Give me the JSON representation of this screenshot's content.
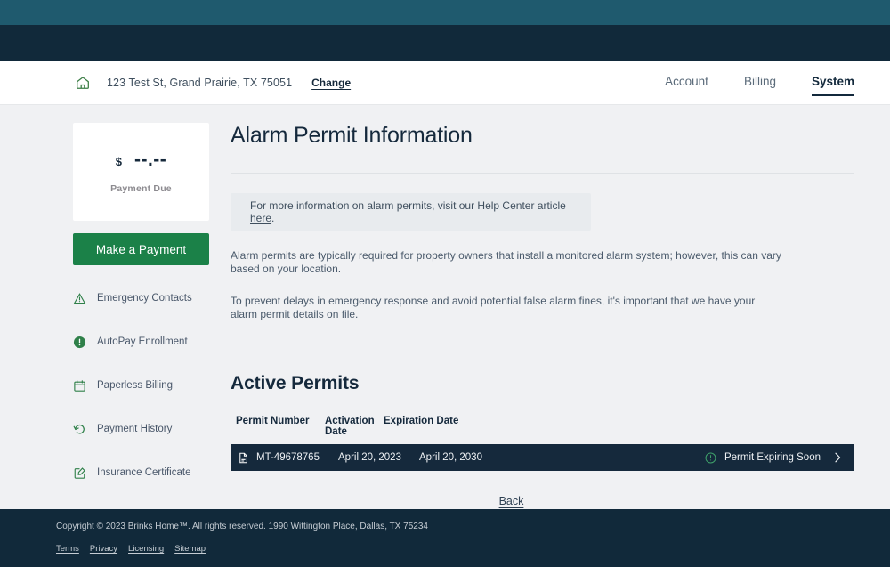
{
  "colors": {
    "top_bar_teal": "#1f5a6e",
    "top_bar_navy": "#11293a",
    "page_bg": "#f0f1f3",
    "brand_green": "#1b8148",
    "dark_navy": "#15293c",
    "status_green": "#3ea06a"
  },
  "header": {
    "home_icon": "home-icon",
    "address": "123 Test St, Grand Prairie, TX 75051",
    "change_label": "Change",
    "nav": [
      {
        "label": "Account",
        "active": false
      },
      {
        "label": "Billing",
        "active": false
      },
      {
        "label": "System",
        "active": true
      }
    ]
  },
  "sidebar": {
    "payment_card": {
      "currency_symbol": "$",
      "amount": "--.--",
      "label": "Payment Due"
    },
    "pay_button_label": "Make a Payment",
    "items": [
      {
        "label": "Emergency Contacts",
        "icon": "warning-triangle-icon"
      },
      {
        "label": "AutoPay Enrollment",
        "icon": "exclamation-circle-icon"
      },
      {
        "label": "Paperless Billing",
        "icon": "calendar-icon"
      },
      {
        "label": "Payment History",
        "icon": "history-icon"
      },
      {
        "label": "Insurance Certificate",
        "icon": "edit-document-icon"
      }
    ]
  },
  "main": {
    "page_title": "Alarm Permit Information",
    "info_banner": {
      "text_before": "For more information on alarm permits, visit our Help Center article ",
      "link_label": "here",
      "text_after": "."
    },
    "paragraphs": [
      "Alarm permits are typically required for property owners that install a monitored alarm system; however, this can vary based on your location.",
      "To prevent delays in emergency response and avoid potential false alarm fines, it's important that we have your alarm permit details on file."
    ],
    "section_title": "Active Permits",
    "table": {
      "columns": [
        "Permit Number",
        "Activation Date",
        "Expiration Date"
      ],
      "rows": [
        {
          "icon": "document-icon",
          "permit_number": "MT-49678765",
          "activation_date": "April 20, 2023",
          "expiration_date": "April 20, 2030",
          "status_icon": "exclamation-circle-outline-icon",
          "status": "Permit Expiring Soon",
          "chevron": "chevron-right-icon"
        }
      ]
    },
    "back_label": "Back"
  },
  "footer": {
    "copyright": "Copyright © 2023 Brinks Home™. All rights reserved. 1990 Wittington Place, Dallas, TX 75234",
    "links": [
      "Terms",
      "Privacy",
      "Licensing",
      "Sitemap"
    ]
  }
}
